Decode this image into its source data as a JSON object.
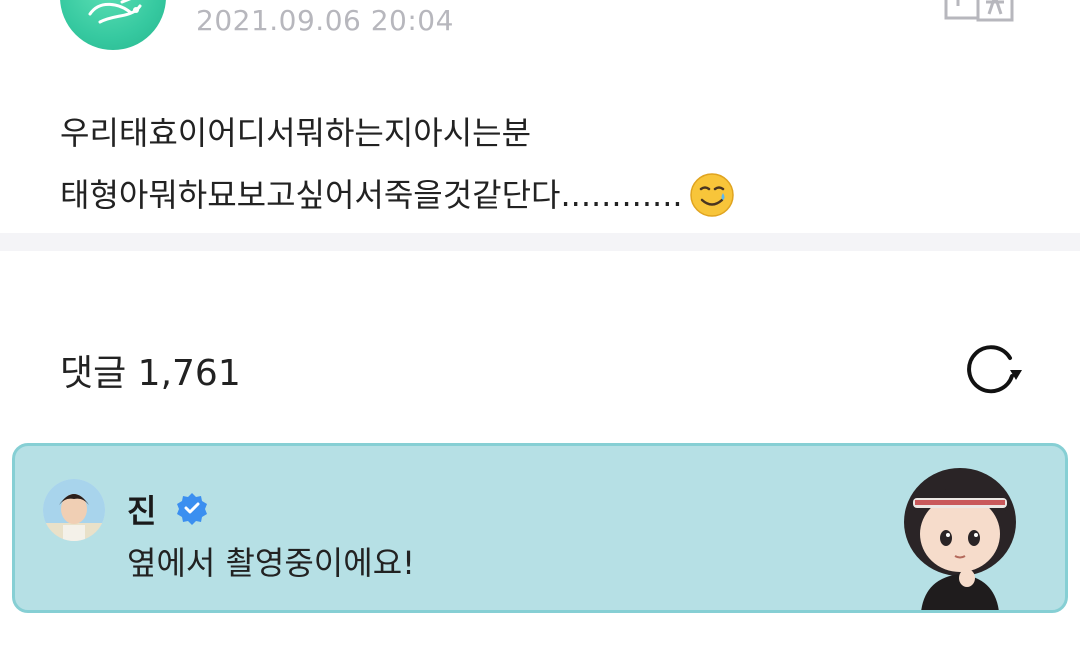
{
  "post": {
    "timestamp": "2021.09.06 20:04",
    "lines": [
      "우리태효이어디서뭐하는지아시는분",
      "태형아뭐하묘보고싶어서죽을것같단다............"
    ],
    "emoji": "smiling-face-with-tear"
  },
  "comments": {
    "header": "댓글 1,761"
  },
  "pinned_comment": {
    "author": "진",
    "text": "옆에서 촬영중이에요!",
    "sticker": "chibi-character-sticker"
  },
  "colors": {
    "card_bg": "#b6e0e5",
    "card_border": "#86cfd4",
    "verified": "#3b8ff0",
    "timestamp": "#b7b7bd",
    "avatar_green": "#36c9a0"
  }
}
